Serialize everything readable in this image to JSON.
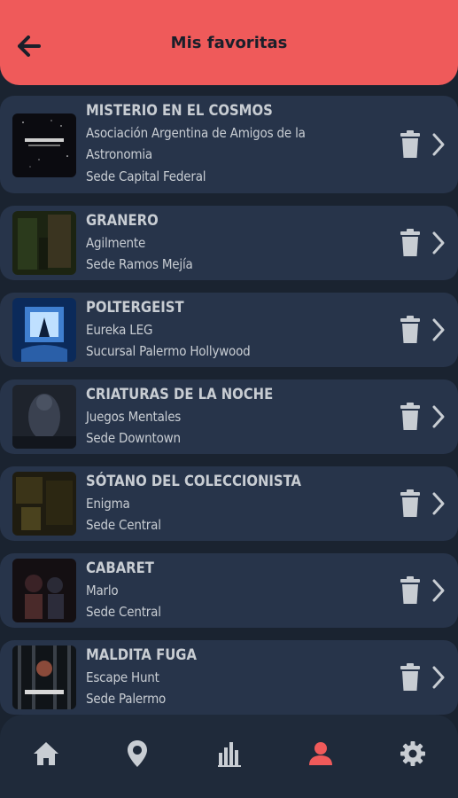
{
  "header": {
    "title": "Mis favoritas",
    "back_icon": "arrow-left-icon"
  },
  "colors": {
    "accent": "#ef5a5a",
    "card": "#27344a",
    "background": "#1a2330",
    "text": "#c8cdd3",
    "icon": "#c8cdd3"
  },
  "favorites": [
    {
      "name": "MISTERIO EN EL COSMOS",
      "company": "Asociación Argentina de Amigos de la Astronomia",
      "location": "Sede Capital Federal"
    },
    {
      "name": "GRANERO",
      "company": "Agilmente",
      "location": "Sede Ramos Mejía"
    },
    {
      "name": "POLTERGEIST",
      "company": "Eureka LEG",
      "location": "Sucursal Palermo Hollywood"
    },
    {
      "name": "CRIATURAS DE LA NOCHE",
      "company": "Juegos Mentales",
      "location": "Sede Downtown"
    },
    {
      "name": "SÓTANO DEL COLECCIONISTA",
      "company": "Enigma",
      "location": "Sede Central"
    },
    {
      "name": "CABARET",
      "company": "Marlo",
      "location": "Sede Central"
    },
    {
      "name": "MALDITA FUGA",
      "company": "Escape Hunt",
      "location": "Sede Palermo"
    }
  ],
  "nav": [
    {
      "icon": "home-icon",
      "active": false
    },
    {
      "icon": "map-pin-icon",
      "active": false
    },
    {
      "icon": "bar-chart-icon",
      "active": false
    },
    {
      "icon": "user-icon",
      "active": true
    },
    {
      "icon": "gear-icon",
      "active": false
    }
  ]
}
